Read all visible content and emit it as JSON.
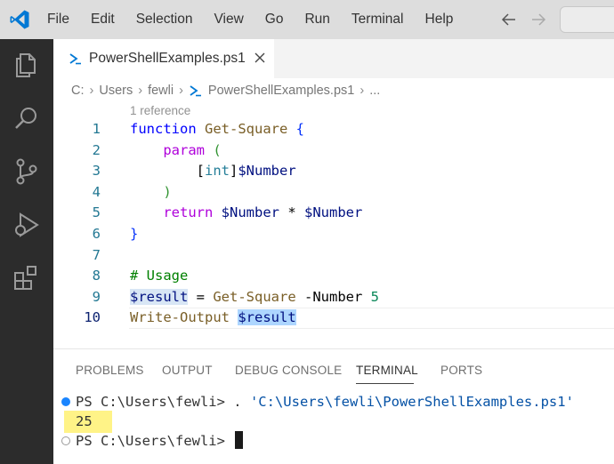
{
  "menu": {
    "items": [
      "File",
      "Edit",
      "Selection",
      "View",
      "Go",
      "Run",
      "Terminal",
      "Help"
    ]
  },
  "activity_bar": {
    "icons": [
      "explorer-icon",
      "search-icon",
      "source-control-icon",
      "run-debug-icon",
      "extensions-icon"
    ]
  },
  "tab": {
    "label": "PowerShellExamples.ps1",
    "icon": "powershell-icon"
  },
  "breadcrumb": {
    "parts": [
      "C:",
      "Users",
      "fewli",
      "PowerShellExamples.ps1",
      "..."
    ]
  },
  "editor": {
    "codelens": "1 reference",
    "line_numbers": [
      "1",
      "2",
      "3",
      "4",
      "5",
      "6",
      "7",
      "8",
      "9",
      "10"
    ],
    "lines": [
      [
        {
          "t": "function",
          "c": "kw2"
        },
        {
          "t": " ",
          "c": ""
        },
        {
          "t": "Get-Square",
          "c": "fn"
        },
        {
          "t": " ",
          "c": ""
        },
        {
          "t": "{",
          "c": "br"
        }
      ],
      [
        {
          "t": "    ",
          "c": ""
        },
        {
          "t": "param",
          "c": "kw"
        },
        {
          "t": " ",
          "c": ""
        },
        {
          "t": "(",
          "c": "br2"
        }
      ],
      [
        {
          "t": "        ",
          "c": ""
        },
        {
          "t": "[",
          "c": "op"
        },
        {
          "t": "int",
          "c": "type"
        },
        {
          "t": "]",
          "c": "op"
        },
        {
          "t": "$Number",
          "c": "var"
        }
      ],
      [
        {
          "t": "    ",
          "c": ""
        },
        {
          "t": ")",
          "c": "br2"
        }
      ],
      [
        {
          "t": "    ",
          "c": ""
        },
        {
          "t": "return",
          "c": "kw"
        },
        {
          "t": " ",
          "c": ""
        },
        {
          "t": "$Number",
          "c": "var"
        },
        {
          "t": " * ",
          "c": "op"
        },
        {
          "t": "$Number",
          "c": "var"
        }
      ],
      [
        {
          "t": "}",
          "c": "br"
        }
      ],
      [],
      [
        {
          "t": "# Usage",
          "c": "cmt"
        }
      ],
      [
        {
          "t": "$result",
          "c": "var hl2"
        },
        {
          "t": " = ",
          "c": "op"
        },
        {
          "t": "Get-Square",
          "c": "fn"
        },
        {
          "t": " -Number ",
          "c": "op"
        },
        {
          "t": "5",
          "c": "num"
        }
      ],
      [
        {
          "t": "Write-Output",
          "c": "fn"
        },
        {
          "t": " ",
          "c": ""
        },
        {
          "t": "$result",
          "c": "var hl"
        }
      ]
    ],
    "active_line": 10
  },
  "panel": {
    "tabs": [
      "PROBLEMS",
      "OUTPUT",
      "DEBUG CONSOLE",
      "TERMINAL",
      "PORTS"
    ],
    "active_tab": "TERMINAL",
    "terminal": {
      "prompt1": "PS C:\\Users\\fewli> . ",
      "command_string": "'C:\\Users\\fewli\\PowerShellExamples.ps1'",
      "output": "25",
      "prompt2": "PS C:\\Users\\fewli> "
    }
  },
  "colors": {
    "activity_bar": "#2c2c2c",
    "titlebar": "#dddddd",
    "vscode_blue": "#0078d4",
    "terminal_dot": "#1a85ff",
    "output_highlight": "#fff387"
  }
}
